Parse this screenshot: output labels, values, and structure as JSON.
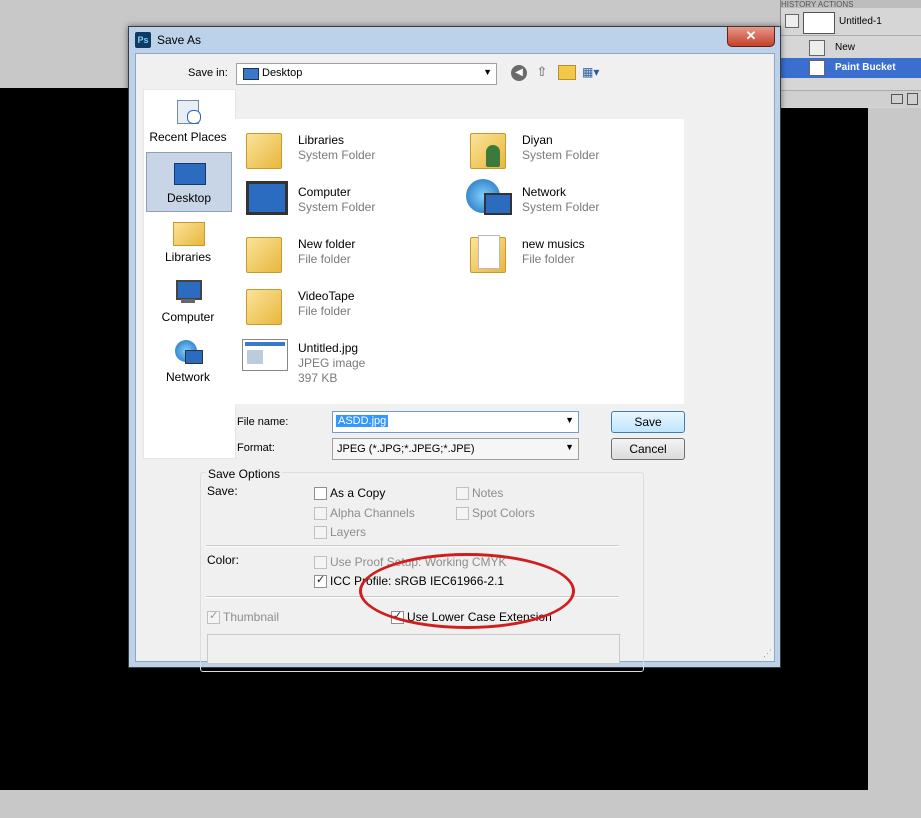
{
  "history": {
    "tabs": "HISTORY   ACTIONS",
    "snapshot_label": "Untitled-1",
    "items": [
      {
        "label": "New"
      },
      {
        "label": "Paint Bucket"
      }
    ]
  },
  "dialog": {
    "title": "Save As",
    "close_symbol": "✕",
    "icon_text": "Ps",
    "save_in_label": "Save in:",
    "save_in_value": "Desktop",
    "places": [
      {
        "label": "Recent Places"
      },
      {
        "label": "Desktop"
      },
      {
        "label": "Libraries"
      },
      {
        "label": "Computer"
      },
      {
        "label": "Network"
      }
    ],
    "files": [
      {
        "name": "Libraries",
        "type": "System Folder"
      },
      {
        "name": "Diyan",
        "type": "System Folder"
      },
      {
        "name": "Computer",
        "type": "System Folder"
      },
      {
        "name": "Network",
        "type": "System Folder"
      },
      {
        "name": "New folder",
        "type": "File folder"
      },
      {
        "name": "new musics",
        "type": "File folder"
      },
      {
        "name": "VideoTape",
        "type": "File folder"
      },
      {
        "name": "Untitled.jpg",
        "type": "JPEG image",
        "size": "397 KB"
      }
    ],
    "file_name_label": "File name:",
    "file_name_value": "ASDD.jpg",
    "format_label": "Format:",
    "format_value": "JPEG (*.JPG;*.JPEG;*.JPE)",
    "save_button": "Save",
    "cancel_button": "Cancel",
    "options": {
      "title": "Save Options",
      "save_label": "Save:",
      "as_a_copy": "As a Copy",
      "notes": "Notes",
      "alpha_channels": "Alpha Channels",
      "spot_colors": "Spot Colors",
      "layers": "Layers",
      "color_label": "Color:",
      "use_proof_setup": "Use Proof Setup:  Working CMYK",
      "icc_profile": "ICC Profile:  sRGB IEC61966-2.1",
      "thumbnail": "Thumbnail",
      "use_lower_case_extension": "Use Lower Case Extension"
    }
  },
  "colors": {
    "annotation": "#d01e1e",
    "selection": "#3399ff"
  }
}
